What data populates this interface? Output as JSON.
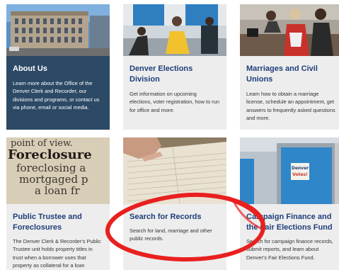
{
  "cards": [
    {
      "title": "About Us",
      "desc": "Learn more about the Office of the Denver Clerk and Recorder, our divisions and programs, or contact us via phone, email or social media."
    },
    {
      "title": "Denver Elections Division",
      "desc": "Get information on upcoming elections, voter registration, how to run for office and more."
    },
    {
      "title": "Marriages and Civil Unions",
      "desc": "Learn how to obtain a marriage license, schedule an appointment, get answers to frequently asked questions and more."
    },
    {
      "title": "Public Trustee and Foreclosures",
      "desc": "The Denver Clerk & Recorder's Public Trustee unit holds property titles in trust when a borrower uses that property as collateral for a loan"
    },
    {
      "title": "Search for Records",
      "desc": "Search for land, marriage and other public records."
    },
    {
      "title": "Campaign Finance and the Fair Elections Fund",
      "desc": "Search for campaign finance records, submit reports, and learn about Denver's Fair Elections Fund."
    }
  ],
  "images": {
    "foreclosure_text": [
      "point of view.",
      "Foreclosure",
      "foreclosing a",
      "mortgaged p",
      "a loan fr"
    ],
    "sign_text": [
      "Denver",
      "Votes!"
    ]
  },
  "colors": {
    "title_blue": "#1f3e7a",
    "about_bg": "#2c4965",
    "card_bg": "#ededed",
    "highlight_red": "#e8201f"
  }
}
